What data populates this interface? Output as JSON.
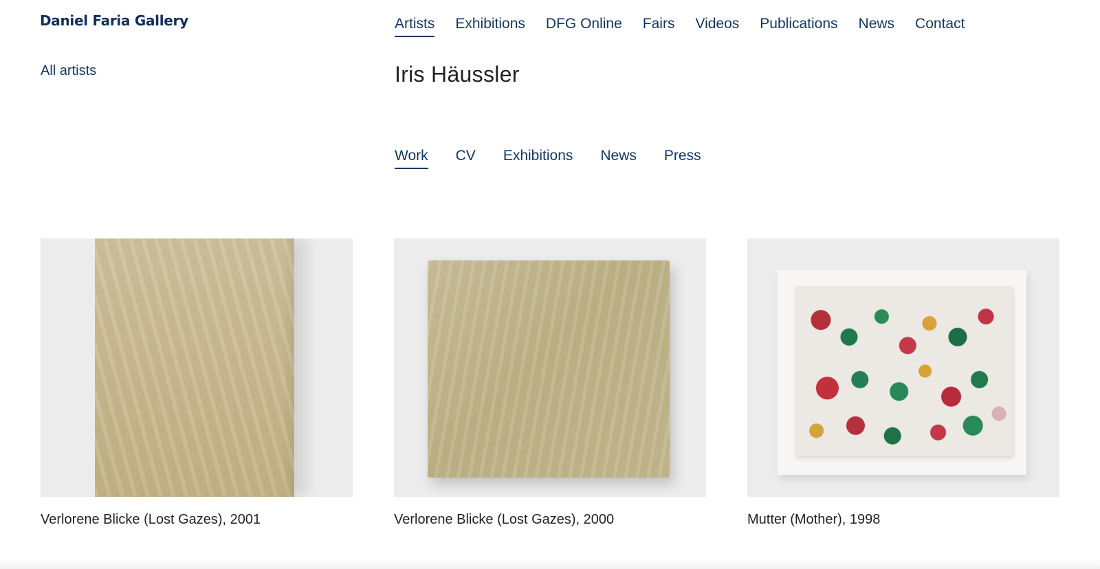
{
  "site": {
    "logo": "Daniel Faria Gallery"
  },
  "main_nav": [
    {
      "label": "Artists",
      "active": true
    },
    {
      "label": "Exhibitions"
    },
    {
      "label": "DFG Online"
    },
    {
      "label": "Fairs"
    },
    {
      "label": "Videos"
    },
    {
      "label": "Publications"
    },
    {
      "label": "News"
    },
    {
      "label": "Contact"
    }
  ],
  "sidebar": {
    "all_artists": "All artists"
  },
  "artist": {
    "name": "Iris Häussler"
  },
  "sub_nav": [
    {
      "label": "Work",
      "active": true
    },
    {
      "label": "CV"
    },
    {
      "label": "Exhibitions"
    },
    {
      "label": "News"
    },
    {
      "label": "Press"
    }
  ],
  "works": [
    {
      "caption": "Verlorene Blicke (Lost Gazes), 2001"
    },
    {
      "caption": "Verlorene Blicke (Lost Gazes), 2000"
    },
    {
      "caption": "Mutter (Mother), 1998"
    }
  ],
  "colors": {
    "brand": "#123766",
    "text": "#222222"
  }
}
